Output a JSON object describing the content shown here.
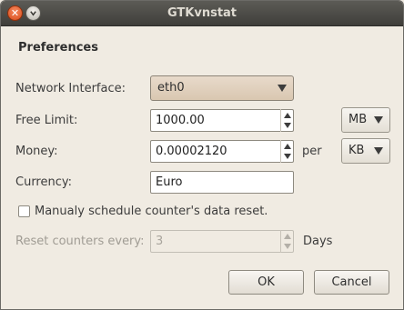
{
  "window": {
    "title": "GTKvnstat"
  },
  "preferences": {
    "heading": "Preferences",
    "network_interface": {
      "label": "Network Interface:",
      "value": "eth0"
    },
    "free_limit": {
      "label": "Free Limit:",
      "value": "1000.00",
      "unit": "MB"
    },
    "money": {
      "label": "Money:",
      "value": "0.00002120",
      "per_label": "per",
      "unit": "KB"
    },
    "currency": {
      "label": "Currency:",
      "value": "Euro"
    },
    "schedule_checkbox": {
      "label": "Manualy schedule counter's data reset.",
      "checked": false
    },
    "reset": {
      "label": "Reset counters every:",
      "value": "3",
      "unit_label": "Days"
    }
  },
  "buttons": {
    "ok": "OK",
    "cancel": "Cancel"
  },
  "icons": {
    "close": "close-icon",
    "minimize": "minimize-icon",
    "dropdown": "chevron-down-icon",
    "spin_up": "spin-up-icon",
    "spin_down": "spin-down-icon"
  },
  "colors": {
    "titlebar": "#4c4b47",
    "window_bg": "#f0ebe2",
    "close_button": "#e2602c"
  }
}
